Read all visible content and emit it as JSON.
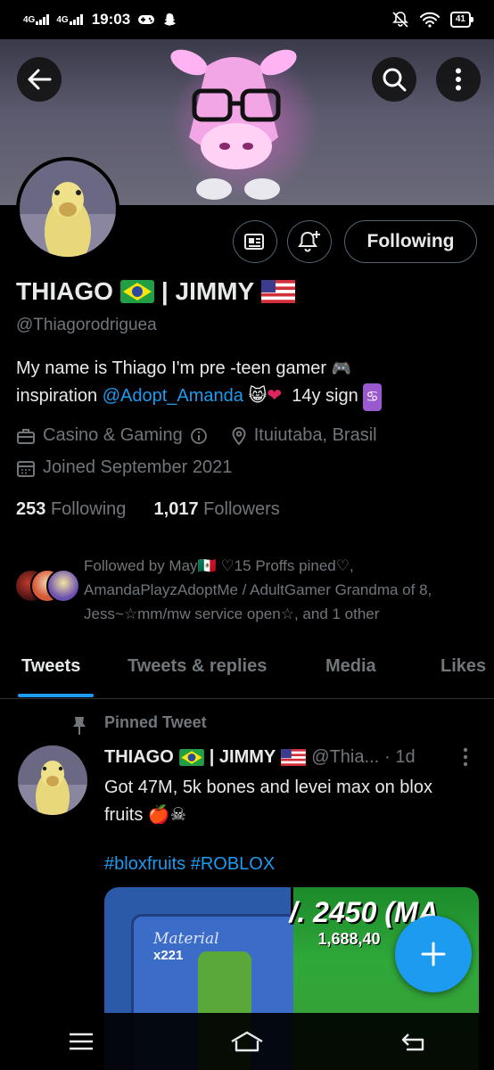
{
  "status_bar": {
    "net1": "4G",
    "net2": "4G",
    "time": "19:03",
    "battery": "41"
  },
  "profile": {
    "display_name_part1": "THIAGO",
    "display_name_part2": "| JIMMY",
    "handle": "@Thiagorodriguea",
    "bio_part1": "My name is Thiago I'm pre -teen gamer",
    "bio_part2": "inspiration",
    "bio_link": "@Adopt_Amanda",
    "bio_part3": "14y  sign",
    "category": "Casino & Gaming",
    "location": "Ituiutaba, Brasil",
    "joined": "Joined September 2021",
    "following_count": "253",
    "following_label": "Following",
    "followers_count": "1,017",
    "followers_label": "Followers",
    "followed_by": "Followed by May🇲🇽 ♡15 Proffs pined♡, AmandaPlayzAdoptMe / AdultGamer Grandma of 8, Jess~☆mm/mw service open☆, and 1 other"
  },
  "buttons": {
    "following": "Following"
  },
  "tabs": [
    {
      "label": "Tweets"
    },
    {
      "label": "Tweets & replies"
    },
    {
      "label": "Media"
    },
    {
      "label": "Likes"
    }
  ],
  "tweet": {
    "pinned_label": "Pinned Tweet",
    "name_part1": "THIAGO",
    "name_part2": "| JIMMY",
    "handle": "@Thia...",
    "time": "· 1d",
    "text": "Got 47M, 5k bones and levei max on blox fruits",
    "hashtags": "#bloxfruits #ROBLOX",
    "media_text1": "Material",
    "media_text2": "x221",
    "media_text3": "/. 2450 (MA",
    "media_text4": "1,688,40"
  },
  "colors": {
    "accent": "#1d9bf0",
    "muted": "#71767b",
    "text": "#e7e9ea",
    "background": "#000000"
  }
}
